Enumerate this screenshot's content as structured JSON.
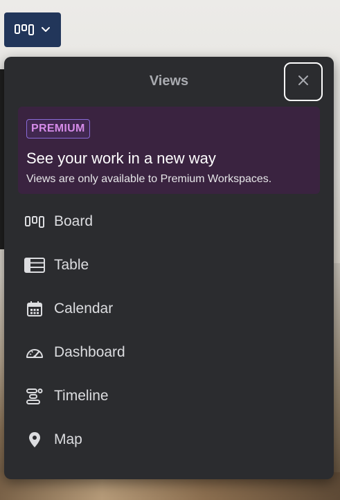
{
  "trigger": {
    "icon": "board-columns-icon",
    "chevron": "chevron-down-icon"
  },
  "popover": {
    "title": "Views",
    "close_icon": "close-icon"
  },
  "premium": {
    "badge": "PREMIUM",
    "heading": "See your work in a new way",
    "text": "Views are only available to Premium Workspaces.",
    "badge_color": "#d58be8",
    "background_color": "#3a2340"
  },
  "views": [
    {
      "label": "Board",
      "icon": "board-icon"
    },
    {
      "label": "Table",
      "icon": "table-icon"
    },
    {
      "label": "Calendar",
      "icon": "calendar-icon"
    },
    {
      "label": "Dashboard",
      "icon": "dashboard-icon"
    },
    {
      "label": "Timeline",
      "icon": "timeline-icon"
    },
    {
      "label": "Map",
      "icon": "map-pin-icon"
    }
  ],
  "colors": {
    "trigger_bg": "#22365a",
    "popover_bg": "#2b2c2f",
    "text": "#dcdde0"
  }
}
